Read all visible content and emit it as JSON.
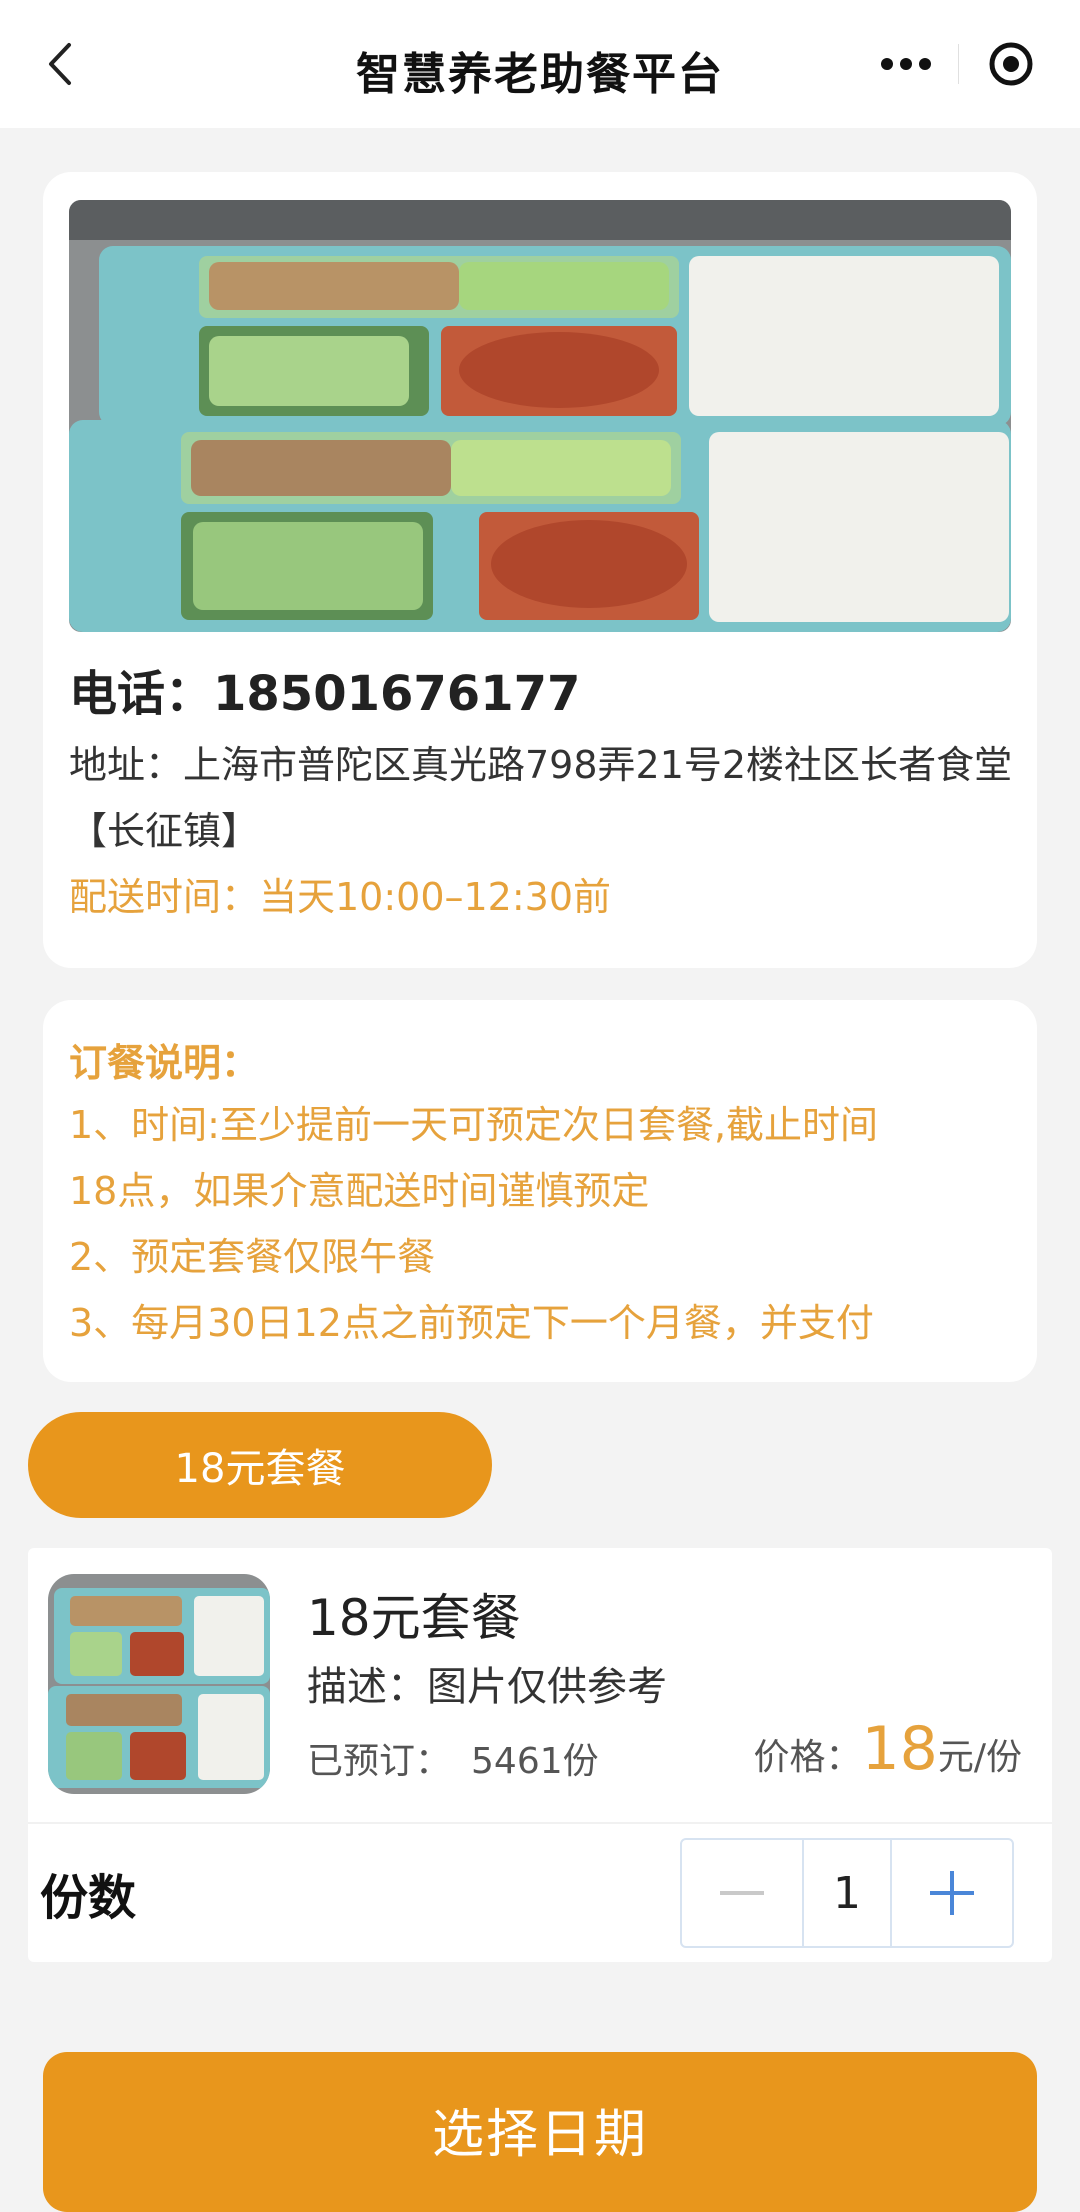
{
  "nav": {
    "title": "智慧养老助餐平台",
    "back_icon": "chevron-left-icon",
    "more_icon": "more-dots-icon",
    "target_icon": "target-circle-icon"
  },
  "info": {
    "phone": "电话：18501676177",
    "address": "地址：上海市普陀区真光路798弄21号2楼社区长者食堂【长征镇】",
    "delivery": "配送时间：当天10:00–12:30前"
  },
  "notes": {
    "title": "订餐说明：",
    "lines": [
      "1、时间:至少提前一天可预定次日套餐,截止时间",
      "18点，如果介意配送时间谨慎预定",
      "2、预定套餐仅限午餐",
      "3、每月30日12点之前预定下一个月餐，并支付"
    ]
  },
  "package_tab": "18元套餐",
  "product": {
    "name": "18元套餐",
    "description": "描述：图片仅供参考",
    "sold_label": "已预订：",
    "sold_count": "5461份",
    "price_label": "价格：",
    "price_amount": "18",
    "price_unit": "元/份"
  },
  "quantity": {
    "label": "份数",
    "value": "1",
    "minus_icon": "minus-icon",
    "plus_icon": "plus-icon"
  },
  "cta": "选择日期",
  "colors": {
    "accent": "#e8961c",
    "accent_text": "#e6a23c",
    "page_bg": "#f3f3f3",
    "stepper_blue": "#4a86d8"
  }
}
